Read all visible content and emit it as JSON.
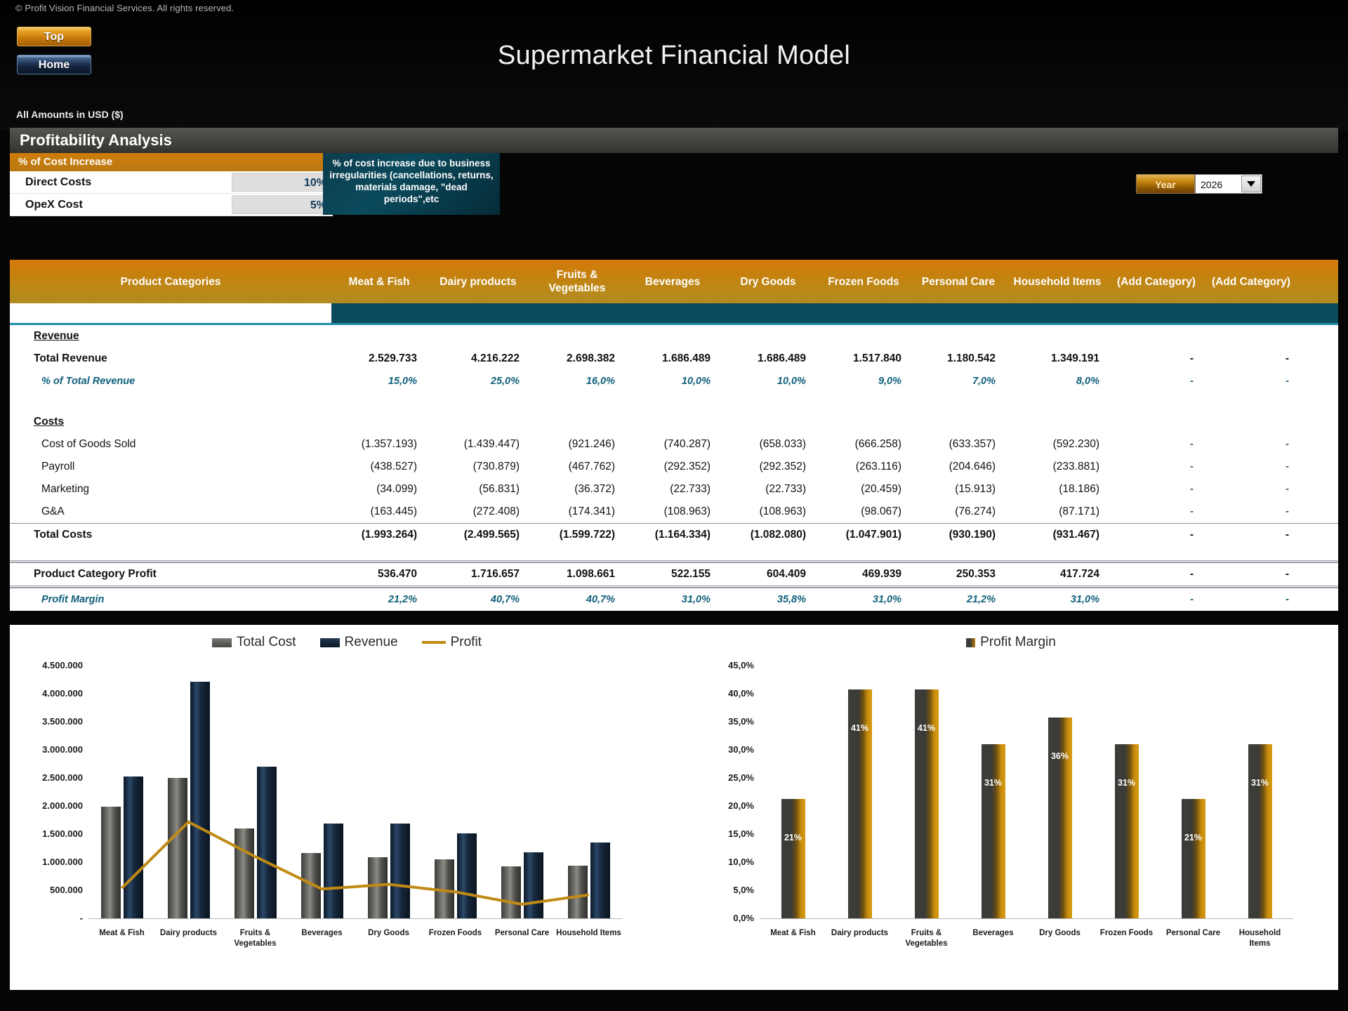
{
  "header": {
    "copyright": "© Profit Vision Financial Services. All rights reserved.",
    "top_button": "Top",
    "home_button": "Home",
    "title": "Supermarket Financial Model",
    "amounts_note": "All Amounts in  USD ($)"
  },
  "section": {
    "title": "Profitability Analysis"
  },
  "cost_increase": {
    "panel_title": "% of Cost Increase",
    "rows": [
      {
        "label": "Direct Costs",
        "value": "10%"
      },
      {
        "label": "OpeX Cost",
        "value": "5%"
      }
    ],
    "tooltip": "% of cost increase due to business irregularities (cancellations, returns, materials damage, \"dead periods\",etc"
  },
  "year_selector": {
    "label": "Year",
    "value": "2026",
    "arrow_icon": "chevron-down-icon"
  },
  "table": {
    "row_header": "Product Categories",
    "columns": [
      "Meat & Fish",
      "Dairy products",
      "Fruits & Vegetables",
      "Beverages",
      "Dry Goods",
      "Frozen Foods",
      "Personal Care",
      "Household Items",
      "(Add Category)",
      "(Add Category)"
    ],
    "sections": [
      {
        "title": "Revenue"
      },
      {
        "title": "Costs"
      }
    ],
    "rows": [
      {
        "label": "Total Revenue",
        "values": [
          "2.529.733",
          "4.216.222",
          "2.698.382",
          "1.686.489",
          "1.686.489",
          "1.517.840",
          "1.180.542",
          "1.349.191",
          "-",
          "-"
        ]
      },
      {
        "label": "% of Total Revenue",
        "values": [
          "15,0%",
          "25,0%",
          "16,0%",
          "10,0%",
          "10,0%",
          "9,0%",
          "7,0%",
          "8,0%",
          "-",
          "-"
        ]
      },
      {
        "label": "Cost of Goods Sold",
        "values": [
          "(1.357.193)",
          "(1.439.447)",
          "(921.246)",
          "(740.287)",
          "(658.033)",
          "(666.258)",
          "(633.357)",
          "(592.230)",
          "-",
          "-"
        ]
      },
      {
        "label": "Payroll",
        "values": [
          "(438.527)",
          "(730.879)",
          "(467.762)",
          "(292.352)",
          "(292.352)",
          "(263.116)",
          "(204.646)",
          "(233.881)",
          "-",
          "-"
        ]
      },
      {
        "label": "Marketing",
        "values": [
          "(34.099)",
          "(56.831)",
          "(36.372)",
          "(22.733)",
          "(22.733)",
          "(20.459)",
          "(15.913)",
          "(18.186)",
          "-",
          "-"
        ]
      },
      {
        "label": "G&A",
        "values": [
          "(163.445)",
          "(272.408)",
          "(174.341)",
          "(108.963)",
          "(108.963)",
          "(98.067)",
          "(76.274)",
          "(87.171)",
          "-",
          "-"
        ]
      },
      {
        "label": "Total Costs",
        "values": [
          "(1.993.264)",
          "(2.499.565)",
          "(1.599.722)",
          "(1.164.334)",
          "(1.082.080)",
          "(1.047.901)",
          "(930.190)",
          "(931.467)",
          "-",
          "-"
        ]
      },
      {
        "label": "Product Category Profit",
        "values": [
          "536.470",
          "1.716.657",
          "1.098.661",
          "522.155",
          "604.409",
          "469.939",
          "250.353",
          "417.724",
          "-",
          "-"
        ]
      },
      {
        "label": "Profit Margin",
        "values": [
          "21,2%",
          "40,7%",
          "40,7%",
          "31,0%",
          "35,8%",
          "31,0%",
          "21,2%",
          "31,0%",
          "-",
          "-"
        ]
      }
    ]
  },
  "chart_data": [
    {
      "type": "bar",
      "title": "",
      "categories": [
        "Meat & Fish",
        "Dairy products",
        "Fruits & Vegetables",
        "Beverages",
        "Dry Goods",
        "Frozen Foods",
        "Personal Care",
        "Household Items"
      ],
      "series": [
        {
          "name": "Total Cost",
          "values": [
            1993264,
            2499565,
            1599722,
            1164334,
            1082080,
            1047901,
            930190,
            931467
          ]
        },
        {
          "name": "Revenue",
          "values": [
            2529733,
            4216222,
            2698382,
            1686489,
            1686489,
            1517840,
            1180542,
            1349191
          ]
        },
        {
          "name": "Profit",
          "type": "line",
          "values": [
            536470,
            1716657,
            1098661,
            522155,
            604409,
            469939,
            250353,
            417724
          ]
        }
      ],
      "ylim": [
        0,
        4500000
      ],
      "yticks": [
        "-",
        "500.000",
        "1.000.000",
        "1.500.000",
        "2.000.000",
        "2.500.000",
        "3.000.000",
        "3.500.000",
        "4.000.000",
        "4.500.000"
      ],
      "xlabel": "",
      "ylabel": "",
      "grid": false,
      "legend_position": "top"
    },
    {
      "type": "bar",
      "title": "",
      "categories": [
        "Meat & Fish",
        "Dairy products",
        "Fruits &\nVegetables",
        "Beverages",
        "Dry Goods",
        "Frozen Foods",
        "Personal Care",
        "Household\nItems"
      ],
      "series": [
        {
          "name": "Profit Margin",
          "values": [
            21.2,
            40.7,
            40.7,
            31.0,
            35.8,
            31.0,
            21.2,
            31.0
          ]
        }
      ],
      "data_labels": [
        "21%",
        "41%",
        "41%",
        "31%",
        "36%",
        "31%",
        "21%",
        "31%"
      ],
      "ylim": [
        0,
        45
      ],
      "yticks": [
        "0,0%",
        "5,0%",
        "10,0%",
        "15,0%",
        "20,0%",
        "25,0%",
        "30,0%",
        "35,0%",
        "40,0%",
        "45,0%"
      ],
      "xlabel": "",
      "ylabel": "",
      "grid": false,
      "legend_position": "top"
    }
  ],
  "colors": {
    "accent_orange": "#c4820f",
    "teal": "#0c4b5e",
    "revenue_navy": "#16263a",
    "cost_gray": "#5e5e5a",
    "profit_line": "#c08a15"
  }
}
